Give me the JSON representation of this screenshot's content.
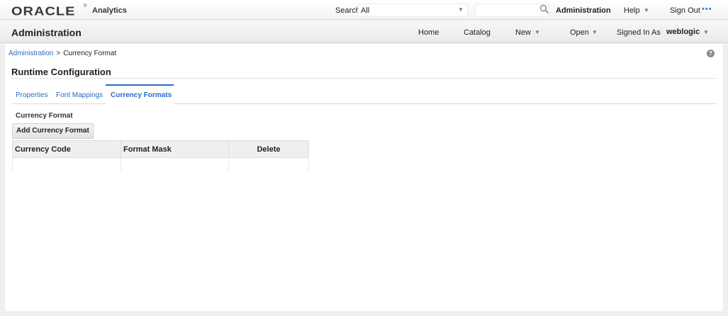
{
  "topbar": {
    "logo_text": "ORACLE",
    "logo_reg": "®",
    "product": "Analytics",
    "search_label": "Search",
    "search_scope": "All",
    "search_placeholder": "",
    "administration": "Administration",
    "help": "Help",
    "sign_out": "Sign Out",
    "more": "•••"
  },
  "navbar": {
    "title": "Administration",
    "home": "Home",
    "catalog": "Catalog",
    "new": "New",
    "open": "Open",
    "signed_in_as": "Signed In As",
    "user": "weblogic"
  },
  "breadcrumb": {
    "root": "Administration",
    "separator": ">",
    "current": "Currency Format"
  },
  "page": {
    "section_title": "Runtime Configuration",
    "help_glyph": "?"
  },
  "tabs": [
    {
      "label": "Properties"
    },
    {
      "label": "Font Mappings"
    },
    {
      "label": "Currency Formats"
    }
  ],
  "currency": {
    "heading": "Currency Format",
    "add_button": "Add Currency Format",
    "columns": [
      "Currency Code",
      "Format Mask",
      "Delete"
    ]
  },
  "colors": {
    "link": "#2b6bc4",
    "accent": "#2b6bc4"
  }
}
